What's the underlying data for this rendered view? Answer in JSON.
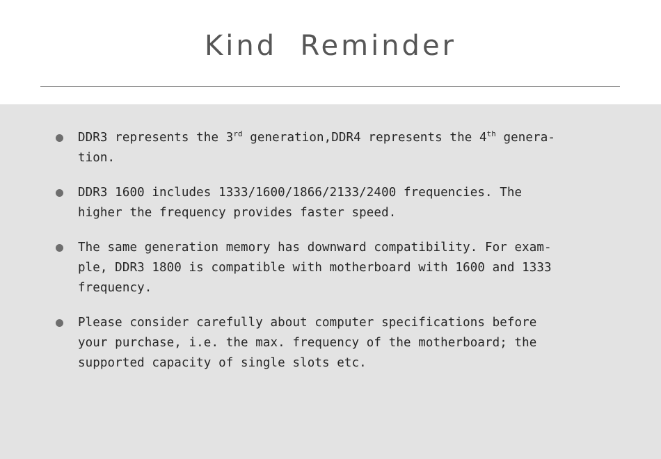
{
  "header": {
    "title": "Kind  Reminder",
    "divider": "horizontal-rule"
  },
  "body": {
    "bullets": [
      {
        "id": "bullet-ddr-generation",
        "marker": "filled-circle-bullet",
        "text_plain": "DDR3 represents the 3rd generation,DDR4 represents the 4th genera-tion.",
        "segments": [
          {
            "type": "text",
            "value": "DDR3 represents the 3"
          },
          {
            "type": "sup",
            "value": "rd"
          },
          {
            "type": "text",
            "value": " generation,DDR4 represents the 4"
          },
          {
            "type": "sup",
            "value": "th"
          },
          {
            "type": "text",
            "value": " genera-\ntion."
          }
        ]
      },
      {
        "id": "bullet-frequencies",
        "marker": "filled-circle-bullet",
        "text_plain": "DDR3 1600 includes 1333/1600/1866/2133/2400 frequencies. The higher the frequency provides faster speed.",
        "segments": [
          {
            "type": "text",
            "value": "DDR3 1600 includes 1333/1600/1866/2133/2400 frequencies. The\nhigher the frequency provides faster speed."
          }
        ]
      },
      {
        "id": "bullet-downward-compatibility",
        "marker": "filled-circle-bullet",
        "text_plain": "The same generation memory has downward compatibility. For exam-ple, DDR3 1800 is compatible with motherboard with 1600 and 1333 frequency.",
        "segments": [
          {
            "type": "text",
            "value": "The same generation memory has downward compatibility. For exam-\nple, DDR3 1800 is compatible with motherboard with 1600 and 1333\nfrequency."
          }
        ]
      },
      {
        "id": "bullet-consider-specifications",
        "marker": "filled-circle-bullet",
        "text_plain": "Please consider carefully about computer specifications before your purchase, i.e. the max. frequency of the motherboard; the supported capacity of single slots etc.",
        "segments": [
          {
            "type": "text",
            "value": "Please consider carefully about computer specifications before\nyour purchase, i.e. the max. frequency of the motherboard; the\nsupported capacity of single slots etc."
          }
        ]
      }
    ]
  },
  "colors": {
    "page_background": "#ffffff",
    "panel_background": "#e3e3e3",
    "title_text": "#565656",
    "body_text": "#262626",
    "bullet_marker": "#6e6e6e",
    "divider": "#8c8c8c"
  }
}
